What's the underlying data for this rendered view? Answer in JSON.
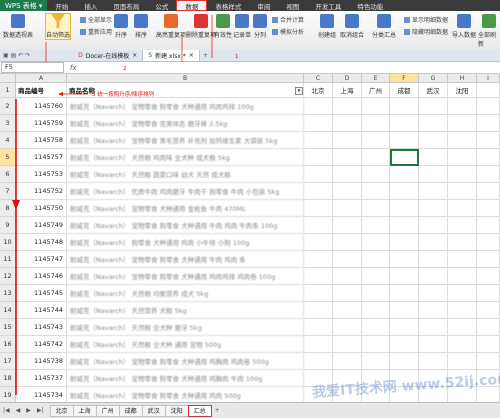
{
  "menubar": {
    "logo": "WPS 表格",
    "items": [
      "开始",
      "插入",
      "页面布局",
      "公式",
      "数据",
      "表格样式",
      "审阅",
      "视图",
      "开发工具",
      "特色功能"
    ],
    "active_index": 4
  },
  "ribbon": {
    "large_buttons": [
      {
        "label": "数据透视表",
        "color": "#4a78c8"
      },
      {
        "label": "自动筛选",
        "color": "#e8b838"
      },
      {
        "label": "升序",
        "color": "#4a78c8"
      },
      {
        "label": "排序",
        "color": "#4a78c8"
      },
      {
        "label": "高亮重复项",
        "color": "#e86a2a"
      },
      {
        "label": "删除重复项",
        "color": "#d33"
      },
      {
        "label": "有效性",
        "color": "#4a9a4a"
      },
      {
        "label": "记录单",
        "color": "#4a78c8"
      },
      {
        "label": "分列",
        "color": "#4a78c8"
      },
      {
        "label": "创建组",
        "color": "#4a78c8"
      },
      {
        "label": "取消组合",
        "color": "#4a78c8"
      },
      {
        "label": "分类汇总",
        "color": "#4a78c8"
      },
      {
        "label": "导入数据",
        "color": "#4a78c8"
      },
      {
        "label": "全部刷新",
        "color": "#4a9a4a"
      }
    ],
    "small_buttons": [
      "全部显示",
      "重新应用",
      "合并计算",
      "模拟分析",
      "显示明细数据",
      "隐藏明细数据"
    ]
  },
  "doc_tabs": [
    {
      "label": "Docer-在线模板"
    },
    {
      "label": "新建.xlsx *"
    }
  ],
  "formula_bar": {
    "name_box": "F5",
    "fx": "fx",
    "value": ""
  },
  "columns": [
    "A",
    "B",
    "C",
    "D",
    "E",
    "F",
    "G",
    "H",
    "I"
  ],
  "selected_column": "F",
  "selected_row": 5,
  "headers": {
    "a1": "商品编号",
    "b1": "商品名称",
    "c1": "北京",
    "d1": "上海",
    "e1": "广州",
    "f1": "成都",
    "g1": "武汉",
    "h1": "沈阳"
  },
  "rows": [
    {
      "num": "2",
      "id": "1145760",
      "name": "耐威克（Navarch） 宠物零食 狗零食 犬种通用 鸡肉鸡排 100g"
    },
    {
      "num": "3",
      "id": "1145759",
      "name": "耐威克（Navarch） 宠物零食 完美体态 磨牙棒 2.5kg"
    },
    {
      "num": "4",
      "id": "1145758",
      "name": "耐威克（Navarch） 宠物零食 美毛营养 补充剂 加钙维生素 大袋装 5kg"
    },
    {
      "num": "5",
      "id": "1145757",
      "name": "耐威克（Navarch） 天然粮 鸡肉味 全犬种 成犬粮 5kg"
    },
    {
      "num": "6",
      "id": "1145753",
      "name": "耐威克（Navarch） 天然粮 蔬菜口味 幼犬 天然 成犬粮"
    },
    {
      "num": "7",
      "id": "1145752",
      "name": "耐威克（Navarch） 优质牛肉 鸡肉磨牙 牛肉干 狗零食 牛肉 小包装 5kg"
    },
    {
      "num": "8",
      "id": "1145750",
      "name": "耐威克（Navarch） 宠物零食 犬种通用 金枪鱼 牛肉 470ML"
    },
    {
      "num": "9",
      "id": "1145749",
      "name": "耐威克（Navarch） 宠物零食 狗零食 犬种通用 牛肉 鸡肉 牛肉条 100g"
    },
    {
      "num": "10",
      "id": "1145748",
      "name": "耐威克（Navarch） 狗零食 犬种通用 鸡肉 小牛排 小狗 100g"
    },
    {
      "num": "11",
      "id": "1145747",
      "name": "耐威克（Navarch） 宠物零食 狗零食 犬种通用 牛肉 鸡肉 条"
    },
    {
      "num": "12",
      "id": "1145746",
      "name": "耐威克（Navarch） 宠物零食 狗零食 犬种通用 鸡肉鸡排 鸡肉卷 100g"
    },
    {
      "num": "13",
      "id": "1145745",
      "name": "耐威克（Navarch） 天然粮 均衡营养 成犬 5kg"
    },
    {
      "num": "14",
      "id": "1145744",
      "name": "耐威克（Navarch） 天然营养 犬粮 5kg"
    },
    {
      "num": "15",
      "id": "1145743",
      "name": "耐威克（Navarch） 天然粮 全犬种 磨牙 5kg"
    },
    {
      "num": "16",
      "id": "1145742",
      "name": "耐威克（Navarch） 天然粮 全犬种 通用 宠物 500g"
    },
    {
      "num": "17",
      "id": "1145738",
      "name": "耐威克（Navarch） 宠物零食 狗零食 犬种通用 鸡胸肉 鸡肉卷 500g"
    },
    {
      "num": "18",
      "id": "1145737",
      "name": "耐威克（Navarch） 宠物零食 狗零食 犬种通用 鸡胸肉 牛肉 100g"
    },
    {
      "num": "19",
      "id": "1145734",
      "name": "耐威克（Navarch） 宠物零食 狗零食 犬种通用 鸡肉 500g"
    }
  ],
  "annotations": {
    "a1_note": "3  统一按照升序/降序排列",
    "num_1": "1",
    "num_2": "2"
  },
  "sheets": [
    "北京",
    "上海",
    "广州",
    "成都",
    "武汉",
    "沈阳",
    "汇总"
  ],
  "active_sheet": "汇总",
  "watermark": "我爱IT技术网 www.52ij.com",
  "colors": {
    "accent": "#1e7a3c",
    "annotation": "#d11",
    "selection": "#ffe39a"
  }
}
